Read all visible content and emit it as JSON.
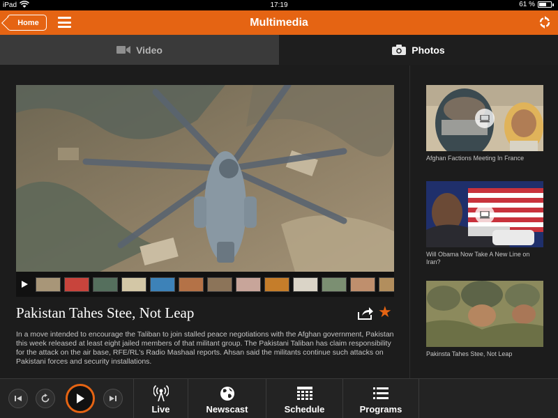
{
  "status": {
    "carrier": "iPad",
    "time": "17:19",
    "battery": "61 %",
    "battery_level": 0.61
  },
  "header": {
    "back_label": "Home",
    "title": "Multimedia"
  },
  "tabs": [
    {
      "label": "Video",
      "active": false
    },
    {
      "label": "Photos",
      "active": true
    }
  ],
  "article": {
    "title": "Pakistan Tahes Stee, Not Leap",
    "body": "In a move intended to encourage the Taliban to join stalled peace negotiations with the Afghan government, Pakistan this week released at least eight jailed members of that militant group. The Pakistani Taliban has claim responsibility for the attack on the air base, RFE/RL's Radio Mashaal reports. Ahsan said the militants continue such attacks on Pakistani forces and security installations."
  },
  "sidebar": {
    "items": [
      {
        "caption": "Afghan Factions Meeting In France"
      },
      {
        "caption": "Will Obama Now Take A New Line on Iran?"
      },
      {
        "caption": "Pakinsta Tahes Stee, Not Leap"
      }
    ]
  },
  "bottom_nav": [
    {
      "label": "Live"
    },
    {
      "label": "Newscast"
    },
    {
      "label": "Schedule"
    },
    {
      "label": "Programs"
    }
  ],
  "colors": {
    "accent": "#e56413",
    "background": "#1c1c1c"
  },
  "icons": [
    "wifi-icon",
    "battery-icon",
    "menu-icon",
    "refresh-icon",
    "video-camera-icon",
    "photo-camera-icon",
    "play-icon",
    "share-icon",
    "star-icon",
    "skip-back-icon",
    "replay-icon",
    "skip-forward-icon",
    "broadcast-icon",
    "globe-icon",
    "calendar-grid-icon",
    "list-icon"
  ]
}
